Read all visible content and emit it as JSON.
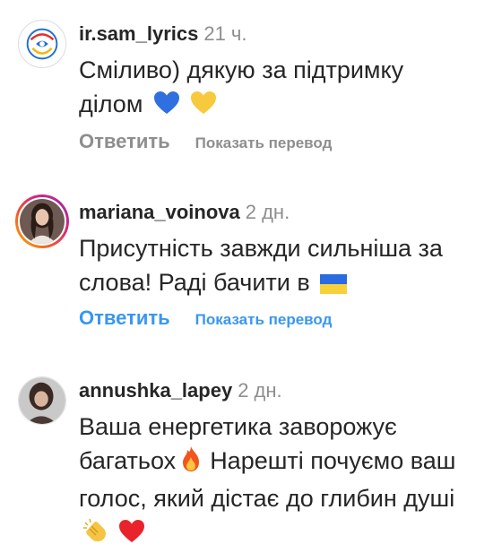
{
  "comments": [
    {
      "username": "ir.sam_lyrics",
      "time": "21 ч.",
      "text": "Сміливо) дякую за підтримку ділом",
      "emoji": [
        "blue-heart",
        "yellow-heart"
      ],
      "reply_label": "Ответить",
      "translate_label": "Показать перевод"
    },
    {
      "username": "mariana_voinova",
      "time": "2 дн.",
      "text": "Присутність завжди сильніша за слова! Раді бачити в",
      "emoji": [
        "ukraine-flag"
      ],
      "reply_label": "Ответить",
      "translate_label": "Показать перевод"
    },
    {
      "username": "annushka_lapey",
      "time": "2 дн.",
      "text_part1": "Ваша енергетика заворожує багатьох",
      "text_part2": "Нарешті почуємо ваш голос, який дістає до глибин душі",
      "emoji": [
        "fire",
        "clapping-hands",
        "red-heart"
      ]
    }
  ],
  "colors": {
    "text": "#262626",
    "secondary": "#8e8e8e",
    "link_blue": "#3897f0",
    "story_ring": [
      "#f9b000",
      "#d6267b",
      "#8f2fb8"
    ]
  }
}
